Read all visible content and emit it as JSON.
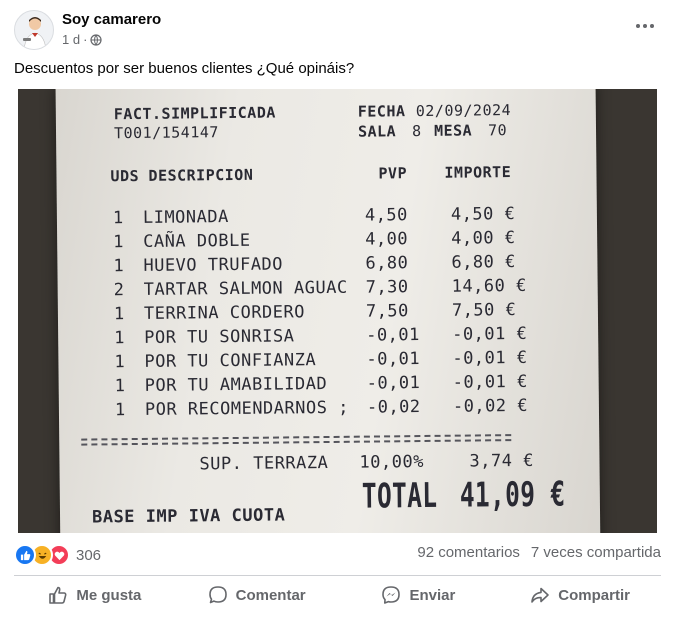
{
  "post": {
    "author": "Soy camarero",
    "time": "1 d",
    "separator": "·",
    "text": "Descuentos por ser buenos clientes ¿Qué opináis?"
  },
  "receipt": {
    "title": "FACT.SIMPLIFICADA",
    "number": "T001/154147",
    "fecha_label": "FECHA",
    "fecha": "02/09/2024",
    "sala_label": "SALA",
    "sala": "8",
    "mesa_label": "MESA",
    "mesa": "70",
    "col_uds": "UDS",
    "col_desc": "DESCRIPCION",
    "col_pvp": "PVP",
    "col_importe": "IMPORTE",
    "items": [
      {
        "uds": "1",
        "desc": "LIMONADA",
        "pvp": "4,50",
        "importe": "4,50 €"
      },
      {
        "uds": "1",
        "desc": "CAÑA DOBLE",
        "pvp": "4,00",
        "importe": "4,00 €"
      },
      {
        "uds": "1",
        "desc": "HUEVO TRUFADO",
        "pvp": "6,80",
        "importe": "6,80 €"
      },
      {
        "uds": "2",
        "desc": "TARTAR SALMON AGUAC",
        "pvp": "7,30",
        "importe": "14,60 €"
      },
      {
        "uds": "1",
        "desc": "TERRINA CORDERO",
        "pvp": "7,50",
        "importe": "7,50 €"
      },
      {
        "uds": "1",
        "desc": "POR TU SONRISA",
        "pvp": "-0,01",
        "importe": "-0,01 €"
      },
      {
        "uds": "1",
        "desc": "POR TU CONFIANZA",
        "pvp": "-0,01",
        "importe": "-0,01 €"
      },
      {
        "uds": "1",
        "desc": "POR TU AMABILIDAD",
        "pvp": "-0,01",
        "importe": "-0,01 €"
      },
      {
        "uds": "1",
        "desc": "POR RECOMENDARNOS ;",
        "pvp": "-0,02",
        "importe": "-0,02 €"
      }
    ],
    "sup_label": "SUP. TERRAZA",
    "sup_pct": "10,00%",
    "sup_amount": "3,74 €",
    "total_label": "TOTAL",
    "total": "41,09 €",
    "base_label": "BASE IMP IVA CUOTA"
  },
  "stats": {
    "reaction_count": "306",
    "comments": "92 comentarios",
    "shares": "7 veces compartida"
  },
  "actions": {
    "like": "Me gusta",
    "comment": "Comentar",
    "send": "Enviar",
    "share": "Compartir"
  },
  "colors": {
    "like_blue": "#1877f2",
    "haha_yellow": "#f7b125",
    "love_red": "#f33e58",
    "muted_text": "#65676b"
  }
}
